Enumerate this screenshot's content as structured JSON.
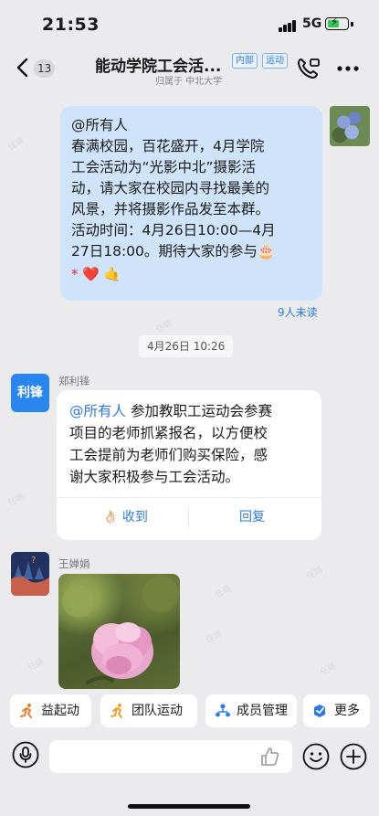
{
  "status_bar": {
    "time": "21:53",
    "network": "5G",
    "battery_level": 0.55
  },
  "header": {
    "title": "能动学院工会活...",
    "tags": [
      "内部",
      "运动"
    ],
    "subtitle": "归属于 中北大学",
    "unread_count": "13"
  },
  "watermark": "任璐",
  "messages": {
    "announcement": {
      "lines": [
        "@所有人",
        "春满校园，百花盛开，4月学院",
        "工会活动为“光影中北”摄影活",
        "动，请大家在校园内寻找最美的",
        "风景，并将摄影作品发至本群。",
        "活动时间：4月26日10:00—4月",
        "27日18:00。期待大家的参与🎂"
      ],
      "emoji_line": "* ❤️ 🤙",
      "read_status": "9人未读"
    },
    "time_separator": "4月26日 10:26",
    "card": {
      "sender_name": "郑利锋",
      "avatar_text": "利锋",
      "mention": "@所有人",
      "text_first": " 参加教职工运动会参赛",
      "text_lines": [
        "项目的老师抓紧报名，以方便校",
        "工会提前为老师们购买保险，感",
        "谢大家积极参与工会活动。"
      ],
      "received_label": "👌🏻 收到",
      "reply_label": "回复"
    },
    "image_message": {
      "sender_name": "王婵娟"
    }
  },
  "quick_actions": [
    {
      "label": "益起动",
      "icon": "running-icon"
    },
    {
      "label": "团队运动",
      "icon": "team-sport-icon"
    },
    {
      "label": "成员管理",
      "icon": "member-manage-icon"
    },
    {
      "label": "更多",
      "icon": "more-apps-icon"
    }
  ],
  "input": {
    "placeholder": ""
  },
  "colors": {
    "accent": "#2d7ae5",
    "bubble_self": "#cfe4fb",
    "background": "#ebebed"
  }
}
